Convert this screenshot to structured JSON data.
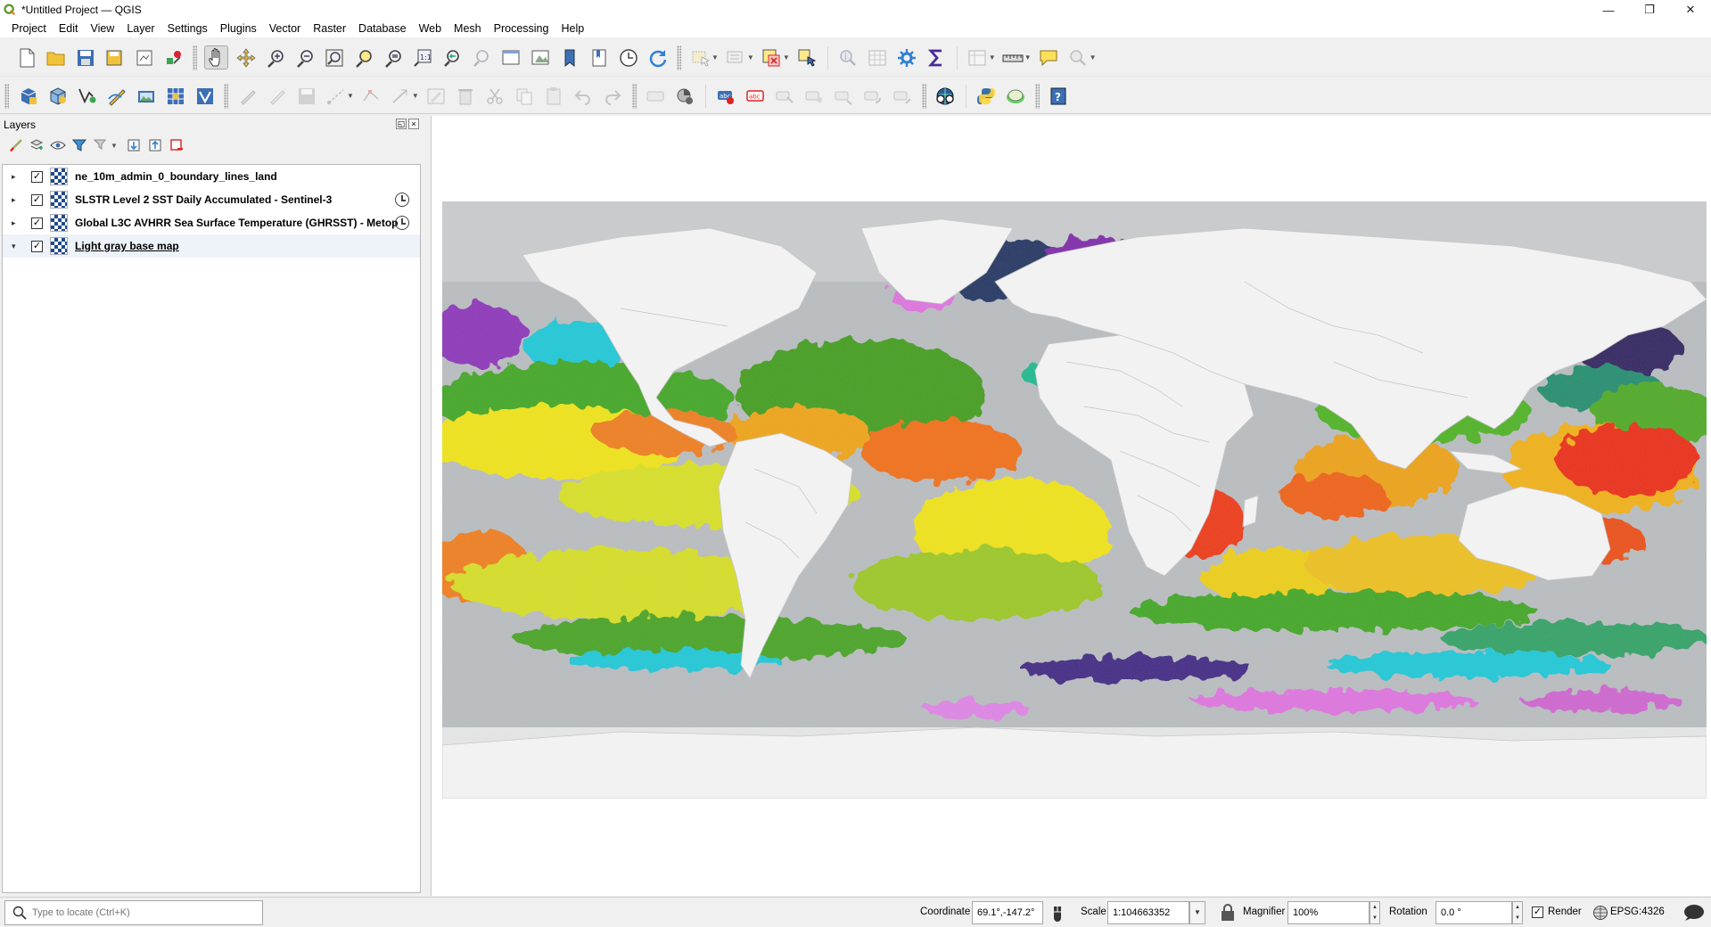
{
  "window": {
    "title": "*Untitled Project — QGIS",
    "minimize": "—",
    "maximize": "❐",
    "close": "✕"
  },
  "menu": [
    "Project",
    "Edit",
    "View",
    "Layer",
    "Settings",
    "Plugins",
    "Vector",
    "Raster",
    "Database",
    "Web",
    "Mesh",
    "Processing",
    "Help"
  ],
  "layers_panel": {
    "title": "Layers",
    "layers": [
      {
        "name": "ne_10m_admin_0_boundary_lines_land",
        "checked": "✓",
        "expand": "▸",
        "temporal": false
      },
      {
        "name": "SLSTR Level 2 SST Daily Accumulated - Sentinel-3",
        "checked": "✓",
        "expand": "▸",
        "temporal": true
      },
      {
        "name": "Global L3C AVHRR Sea Surface Temperature (GHRSST) - Metop",
        "checked": "✓",
        "expand": "▸",
        "temporal": true
      },
      {
        "name": "Light gray base map",
        "checked": "✓",
        "expand": "▾",
        "temporal": false
      }
    ]
  },
  "statusbar": {
    "locator_placeholder": "Type to locate (Ctrl+K)",
    "coordinate_label": "Coordinate",
    "coordinate_value": "69.1°,-147.2°",
    "scale_label": "Scale",
    "scale_value": "1:104663352",
    "magnifier_label": "Magnifier",
    "magnifier_value": "100%",
    "rotation_label": "Rotation",
    "rotation_value": "0.0 °",
    "render_label": "Render",
    "render_checked": "✓",
    "crs": "EPSG:4326"
  },
  "colors": {
    "ocean_gray": "#b9bcbf",
    "land": "#f2f2f2",
    "sst_cold": "#6b1fa8",
    "sst_cool": "#12c8d8",
    "sst_mild": "#3aa51c",
    "sst_warm": "#f3e60a",
    "sst_hot": "#f03010"
  }
}
